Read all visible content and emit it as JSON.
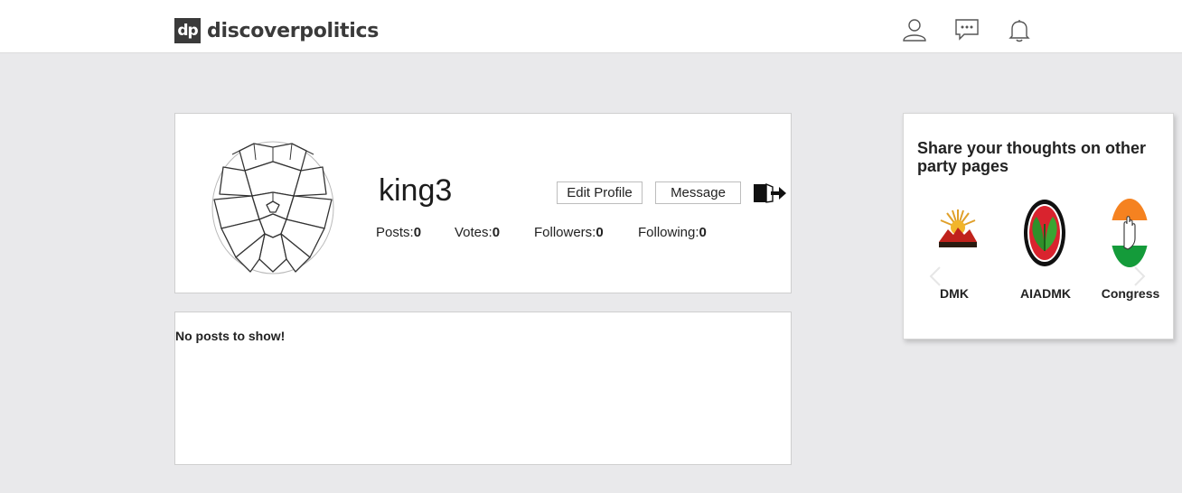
{
  "header": {
    "brand_mark": "dp",
    "brand_name": "discoverpolitics",
    "icons": [
      "user-icon",
      "chat-icon",
      "bell-icon"
    ]
  },
  "profile": {
    "username": "king3",
    "edit_label": "Edit Profile",
    "message_label": "Message",
    "stats": [
      {
        "label": "Posts:",
        "value": "0"
      },
      {
        "label": "Votes:",
        "value": "0"
      },
      {
        "label": "Followers:",
        "value": "0"
      },
      {
        "label": "Following:",
        "value": "0"
      }
    ]
  },
  "posts": {
    "empty_text": "No posts to show!"
  },
  "sidebar": {
    "title": "Share your thoughts on other party pages",
    "parties": [
      {
        "name": "DMK",
        "color": "#e0a02a"
      },
      {
        "name": "AIADMK",
        "color": "#d9232e"
      },
      {
        "name": "Congress",
        "color": "#f58220"
      }
    ]
  },
  "colors": {
    "page_bg": "#e9e9eb",
    "brand": "#3a3a3a"
  }
}
